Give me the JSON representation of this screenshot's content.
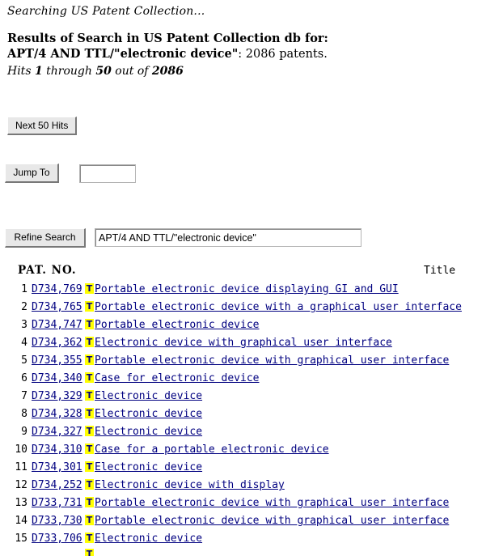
{
  "status": {
    "searching_text": "Searching US Patent Collection..."
  },
  "heading": {
    "results_line": "Results of Search in US Patent Collection db for:",
    "query_bold": "APT/4 AND TTL/\"electronic device\"",
    "query_suffix": ": 2086 patents.",
    "hits_prefix": "Hits ",
    "hits_from": "1",
    "hits_mid": " through ",
    "hits_to": "50",
    "hits_outof": " out of ",
    "hits_total": "2086"
  },
  "controls": {
    "next_50_label": "Next 50 Hits",
    "jump_to_label": "Jump To",
    "jump_to_value": "",
    "jump_to_placeholder": "",
    "refine_search_label": "Refine Search",
    "refine_search_value": "APT/4 AND TTL/\"electronic device\"",
    "refine_search_placeholder": ""
  },
  "table": {
    "col_patno": "PAT. NO.",
    "col_title": "Title",
    "icon_glyph": "T",
    "icon_name": "text-document-icon",
    "rows": [
      {
        "num": "1",
        "patno": "D734,769",
        "title": "Portable electronic device displaying GI and GUI"
      },
      {
        "num": "2",
        "patno": "D734,765",
        "title": "Portable electronic device with a graphical user interface"
      },
      {
        "num": "3",
        "patno": "D734,747",
        "title": "Portable electronic device"
      },
      {
        "num": "4",
        "patno": "D734,362",
        "title": "Electronic device with graphical user interface"
      },
      {
        "num": "5",
        "patno": "D734,355",
        "title": "Portable electronic device with graphical user interface"
      },
      {
        "num": "6",
        "patno": "D734,340",
        "title": "Case for electronic device"
      },
      {
        "num": "7",
        "patno": "D734,329",
        "title": "Electronic device"
      },
      {
        "num": "8",
        "patno": "D734,328",
        "title": "Electronic device"
      },
      {
        "num": "9",
        "patno": "D734,327",
        "title": "Electronic device"
      },
      {
        "num": "10",
        "patno": "D734,310",
        "title": "Case for a portable electronic device"
      },
      {
        "num": "11",
        "patno": "D734,301",
        "title": "Electronic device"
      },
      {
        "num": "12",
        "patno": "D734,252",
        "title": "Electronic device with display"
      },
      {
        "num": "13",
        "patno": "D733,731",
        "title": "Portable electronic device with graphical user interface"
      },
      {
        "num": "14",
        "patno": "D733,730",
        "title": "Portable electronic device with graphical user interface"
      },
      {
        "num": "15",
        "patno": "D733,706",
        "title": "Electronic device"
      }
    ]
  },
  "colors": {
    "link": "#000080",
    "icon_background": "#ffff00",
    "page_background": "#ffffff",
    "button_face": "#e8e8e8"
  }
}
